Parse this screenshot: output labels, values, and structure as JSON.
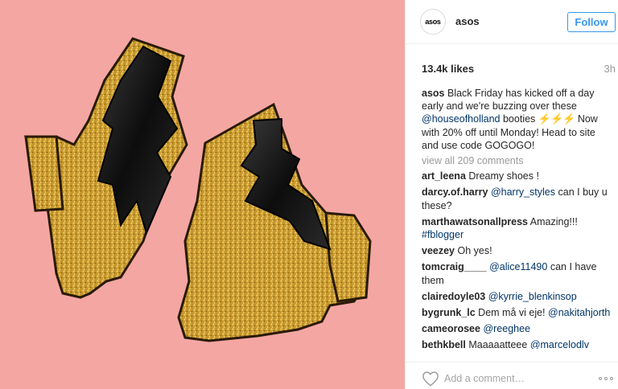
{
  "account": {
    "avatar_logo_text": "asos",
    "username": "asos",
    "follow_label": "Follow"
  },
  "post": {
    "likes": "13.4k likes",
    "time_ago": "3h",
    "caption": {
      "author": "asos",
      "text_1": "Black Friday has kicked off a day early and we're buzzing over these",
      "mention": "@houseofholland",
      "text_2": "booties",
      "emoji": "⚡⚡⚡",
      "text_3": "Now with 20% off until Monday! Head to site and use code GOGOGO!"
    },
    "view_all_comments": "view all 209 comments",
    "comments": [
      {
        "author": "art_leena",
        "mention": "",
        "text": "Dreamy shoes !"
      },
      {
        "author": "darcy.of.harry",
        "mention": "@harry_styles",
        "text": "can I buy u these?"
      },
      {
        "author": "marthawatsonallpress",
        "mention": "",
        "text": "Amazing!!!",
        "tag": "#fblogger"
      },
      {
        "author": "veezey",
        "mention": "",
        "text": "Oh yes!"
      },
      {
        "author": "tomcraig____",
        "mention": "@alice11490",
        "text": "can I have them"
      },
      {
        "author": "clairedoyle03",
        "mention": "@kyrrie_blenkinsop",
        "text": ""
      },
      {
        "author": "bygrunk_lc",
        "text_before": "Dem må vi eje!",
        "mention": "@nakitahjorth",
        "text": ""
      },
      {
        "author": "cameorosee",
        "mention": "@reeghee",
        "text": ""
      },
      {
        "author": "bethkbell",
        "text_before": "Maaaaatteee",
        "mention": "@marcelodlv",
        "text": ""
      }
    ]
  },
  "footer": {
    "comment_placeholder": "Add a comment…"
  },
  "colors": {
    "background_photo": "#f4a6a3",
    "glitter_gold": "#c99a2e",
    "patent_black": "#111111",
    "link_blue": "#3897f0",
    "mention_navy": "#003569"
  },
  "icons": {
    "like": "heart-outline-icon",
    "more": "ellipsis-icon"
  }
}
